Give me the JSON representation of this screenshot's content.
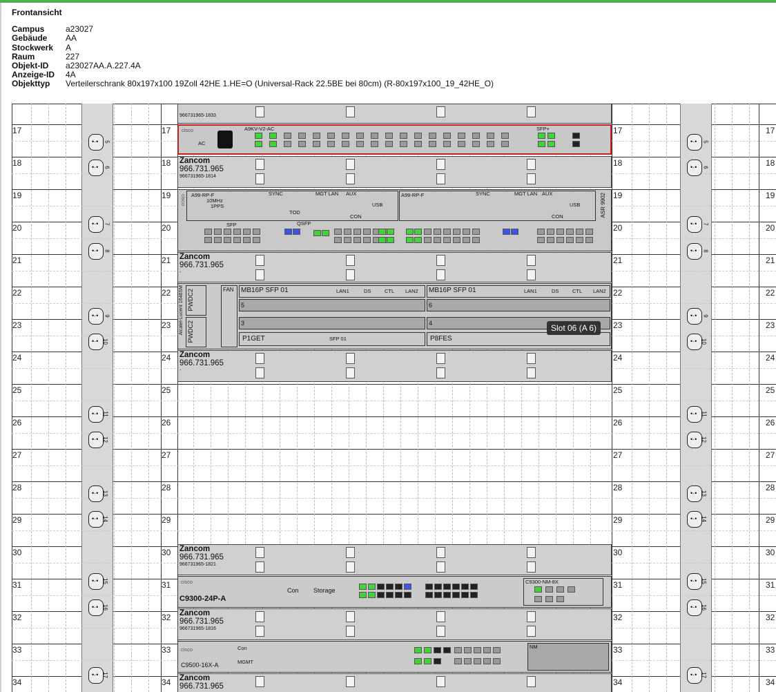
{
  "header": {
    "title": "Frontansicht",
    "fields": [
      {
        "key": "Campus",
        "value": "a23027"
      },
      {
        "key": "Gebäude",
        "value": "AA"
      },
      {
        "key": "Stockwerk",
        "value": "A"
      },
      {
        "key": "Raum",
        "value": "227"
      },
      {
        "key": "Objekt-ID",
        "value": "a23027AA.A.227.4A"
      },
      {
        "key": "Anzeige-ID",
        "value": "4A"
      },
      {
        "key": "Objekttyp",
        "value": "Verteilerschrank 80x197x100 19Zoll 42HE 1.HE=O (Universal-Rack 22.5BE bei 80cm) (R-80x197x100_19_42HE_O)"
      }
    ]
  },
  "units": [
    "17",
    "18",
    "19",
    "20",
    "21",
    "22",
    "23",
    "24",
    "25",
    "26",
    "27",
    "28",
    "29",
    "30",
    "31",
    "32",
    "33",
    "34"
  ],
  "outlets": [
    "5",
    "6",
    "7",
    "8",
    "9",
    "10",
    "11",
    "12",
    "13",
    "14",
    "15",
    "16",
    "17"
  ],
  "devices": {
    "top_serial": "966731965-1833",
    "u17": {
      "brand": "cisco",
      "model": "A9KV-V2-AC",
      "ac": "AC",
      "sfp": "SFP+"
    },
    "u18": {
      "brand": "Zancom",
      "tel": "966.731.965",
      "serial": "966731965-1814"
    },
    "u19": {
      "brand": "cisco",
      "model_l": "A99-RP-F",
      "model_r": "A99-RP-F",
      "sync": "SYNC",
      "mgt": "MGT LAN",
      "aux": "AUX",
      "mhz": "10MHz",
      "pps": "1PPS",
      "tod": "TOD",
      "usb": "USB",
      "con": "CON",
      "asr": "ASR 9902",
      "sfp": "SFP",
      "qsfp": "QSFP"
    },
    "u21": {
      "brand": "Zancom",
      "tel": "966.731.965",
      "serial": "-"
    },
    "u22": {
      "vendor": "Alcatel-Lucent 1646SM",
      "pwdc": "PWDC2",
      "fan": "FAN",
      "slot_l": "MB16P  SFP 01",
      "slot_r": "MB16P  SFP 01",
      "lan1": "LAN1",
      "ds": "DS",
      "ctl": "CTL",
      "lan2": "LAN2",
      "row5": "5",
      "row6": "6",
      "row3": "3",
      "row4": "4",
      "p1get": "P1GET",
      "sfp01": "SFP 01",
      "p8fes": "P8FES"
    },
    "u24": {
      "brand": "Zancom",
      "tel": "966.731.965",
      "serial": "-"
    },
    "u30": {
      "brand": "Zancom",
      "tel": "966.731.965",
      "serial": "966731965-1821"
    },
    "u31": {
      "brand": "cisco",
      "model": "C9300-24P-A",
      "con": "Con",
      "storage": "Storage",
      "nm": "C9300-NM-8X"
    },
    "u32": {
      "brand": "Zancom",
      "tel": "966.731.965",
      "serial": "966731965-1816"
    },
    "u33": {
      "brand": "cisco",
      "model": "C9500-16X-A",
      "con": "Con",
      "mgmt": "MGMT",
      "nm": "NM"
    },
    "u34": {
      "brand": "Zancom",
      "tel": "966.731.965"
    }
  },
  "tooltip": "Slot 06 (A 6)",
  "colors": {
    "accent": "#4cae4f",
    "port_green": "#44d13a",
    "port_blue": "#3b55e8",
    "highlight": "#d00000"
  }
}
